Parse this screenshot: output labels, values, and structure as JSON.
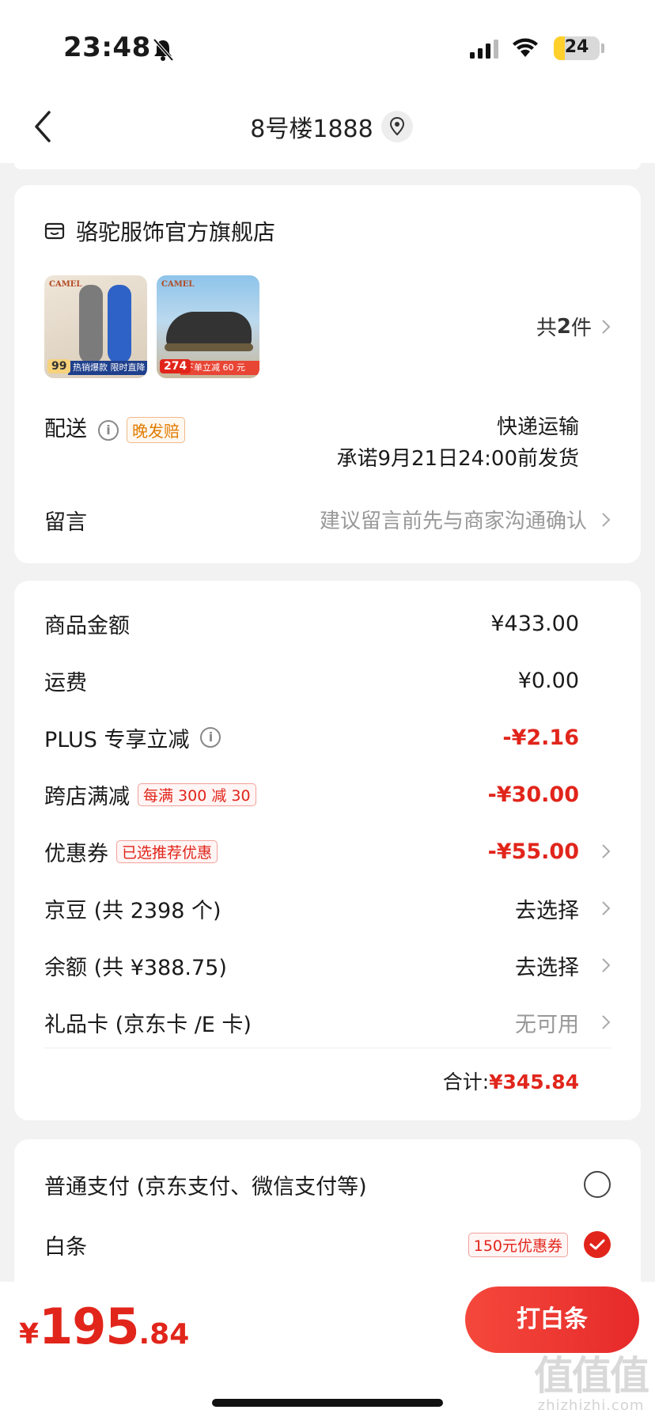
{
  "status_bar": {
    "time": "23:48",
    "battery": "24",
    "battery_level": 0.24
  },
  "nav": {
    "title": "8号楼1888"
  },
  "store": {
    "name": "骆驼服饰官方旗舰店",
    "products": [
      {
        "brand": "CAMEL",
        "price": "99",
        "promo": "热销爆款 限时直降"
      },
      {
        "brand": "CAMEL",
        "price": "274",
        "promo": "下单立减 60 元"
      }
    ],
    "count_prefix": "共",
    "count": "2",
    "count_suffix": "件",
    "delivery_label": "配送",
    "delivery_tag": "晚发赔",
    "delivery_method": "快递运输",
    "delivery_promise": "承诺9月21日24:00前发货",
    "remark_label": "留言",
    "remark_placeholder": "建议留言前先与商家沟通确认"
  },
  "price_summary": {
    "rows": [
      {
        "label": "商品金额",
        "value": "¥433.00"
      },
      {
        "label": "运费",
        "value": "¥0.00"
      },
      {
        "label": "PLUS 专享立减",
        "value": "-¥2.16"
      },
      {
        "label": "跨店满减",
        "tag": "每满 300 减 30",
        "value": "-¥30.00"
      },
      {
        "label": "优惠券",
        "tag": "已选推荐优惠",
        "value": "-¥55.00"
      },
      {
        "label": "京豆 (共 2398 个)",
        "value": "去选择"
      },
      {
        "label": "余额 (共 ¥388.75)",
        "value": "去选择"
      },
      {
        "label": "礼品卡 (京东卡 /E 卡)",
        "value": "无可用"
      }
    ],
    "total_label": "合计:",
    "total_value": "¥345.84"
  },
  "payment": {
    "options": [
      {
        "label": "普通支付 (京东支付、微信支付等)",
        "selected": false
      },
      {
        "label": "白条",
        "tag": "150元优惠券",
        "selected": true
      }
    ]
  },
  "bottom": {
    "currency": "¥",
    "price_int": "195",
    "price_dec": ".84",
    "pay_button": "打白条"
  },
  "watermark": {
    "main": "值值值",
    "sub": "zhizhizhi.com"
  },
  "colors": {
    "accent": "#e1251b",
    "background": "#f2f2f2"
  }
}
